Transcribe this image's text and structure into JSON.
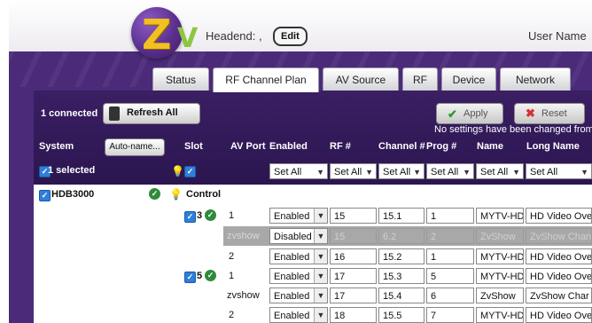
{
  "header": {
    "headend_label": "Headend: ,",
    "edit_button": "Edit",
    "user_label": "User Name"
  },
  "tabs": [
    "Status",
    "RF Channel Plan",
    "AV Source",
    "RF",
    "Device",
    "Network"
  ],
  "active_tab": "RF Channel Plan",
  "toolbar": {
    "connected": "1 connected",
    "refresh_button": "Refresh All",
    "apply_button": "Apply",
    "reset_button": "Reset",
    "notice": "No settings have been changed from"
  },
  "columns": {
    "system": "System",
    "auto_name_button": "Auto-name...",
    "slot": "Slot",
    "av_port": "AV Port",
    "enabled": "Enabled",
    "rf": "RF #",
    "channel": "Channel #",
    "prog": "Prog #",
    "name": "Name",
    "long_name": "Long Name"
  },
  "selection": {
    "selected_text": "1 selected",
    "set_all_enabled": "Set All",
    "set_all_rf": "Set All",
    "set_all_channel": "Set All",
    "set_all_prog": "Set All",
    "set_all_name": "Set All",
    "set_all_long_name": "Set All"
  },
  "device": {
    "name": "HDB3000",
    "control_label": "Control"
  },
  "rows": [
    {
      "slot": "3",
      "av_port": "1",
      "enabled": "Enabled",
      "rf": "15",
      "channel": "15.1",
      "prog": "1",
      "name": "MYTV-HD",
      "long_name": "HD Video Ove"
    },
    {
      "slot": "",
      "av_port": "zvshow",
      "enabled": "Disabled",
      "rf": "15",
      "channel": "6.2",
      "prog": "2",
      "name": "ZvShow",
      "long_name": "ZvShow Chan"
    },
    {
      "slot": "",
      "av_port": "2",
      "enabled": "Enabled",
      "rf": "16",
      "channel": "15.2",
      "prog": "1",
      "name": "MYTV-HD",
      "long_name": "HD Video Ove"
    },
    {
      "slot": "5",
      "av_port": "1",
      "enabled": "Enabled",
      "rf": "17",
      "channel": "15.3",
      "prog": "5",
      "name": "MYTV-HD",
      "long_name": "HD Video Ove"
    },
    {
      "slot": "",
      "av_port": "zvshow",
      "enabled": "Enabled",
      "rf": "17",
      "channel": "15.4",
      "prog": "6",
      "name": "ZvShow",
      "long_name": "ZvShow Char"
    },
    {
      "slot": "",
      "av_port": "2",
      "enabled": "Enabled",
      "rf": "18",
      "channel": "15.5",
      "prog": "7",
      "name": "MYTV-HD",
      "long_name": "HD Video Ove"
    }
  ]
}
